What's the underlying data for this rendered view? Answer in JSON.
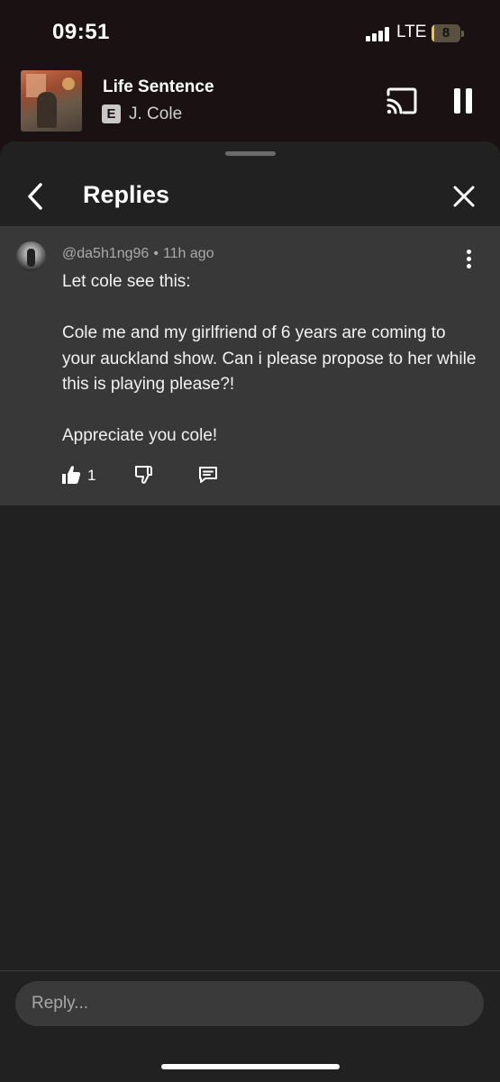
{
  "status_bar": {
    "time": "09:51",
    "network": "LTE",
    "battery": "8",
    "battery_level": 0.08
  },
  "mini_player": {
    "song_title": "Life Sentence",
    "explicit_badge": "E",
    "artist": "J. Cole"
  },
  "sheet": {
    "title": "Replies"
  },
  "comment": {
    "username": "@da5h1ng96",
    "separator": "•",
    "timestamp": "11h ago",
    "paragraphs": [
      "Let cole see this:",
      "Cole me and my girlfriend of 6 years are coming to your auckland show. Can i please propose to her while this is playing please?!",
      "Appreciate you cole!"
    ],
    "like_count": "1"
  },
  "reply_bar": {
    "placeholder": "Reply..."
  },
  "icons": [
    "cast-icon",
    "pause-icon",
    "back-chevron-icon",
    "close-icon",
    "more-vert-icon",
    "thumb-up-icon",
    "thumb-down-icon",
    "reply-comment-icon"
  ]
}
